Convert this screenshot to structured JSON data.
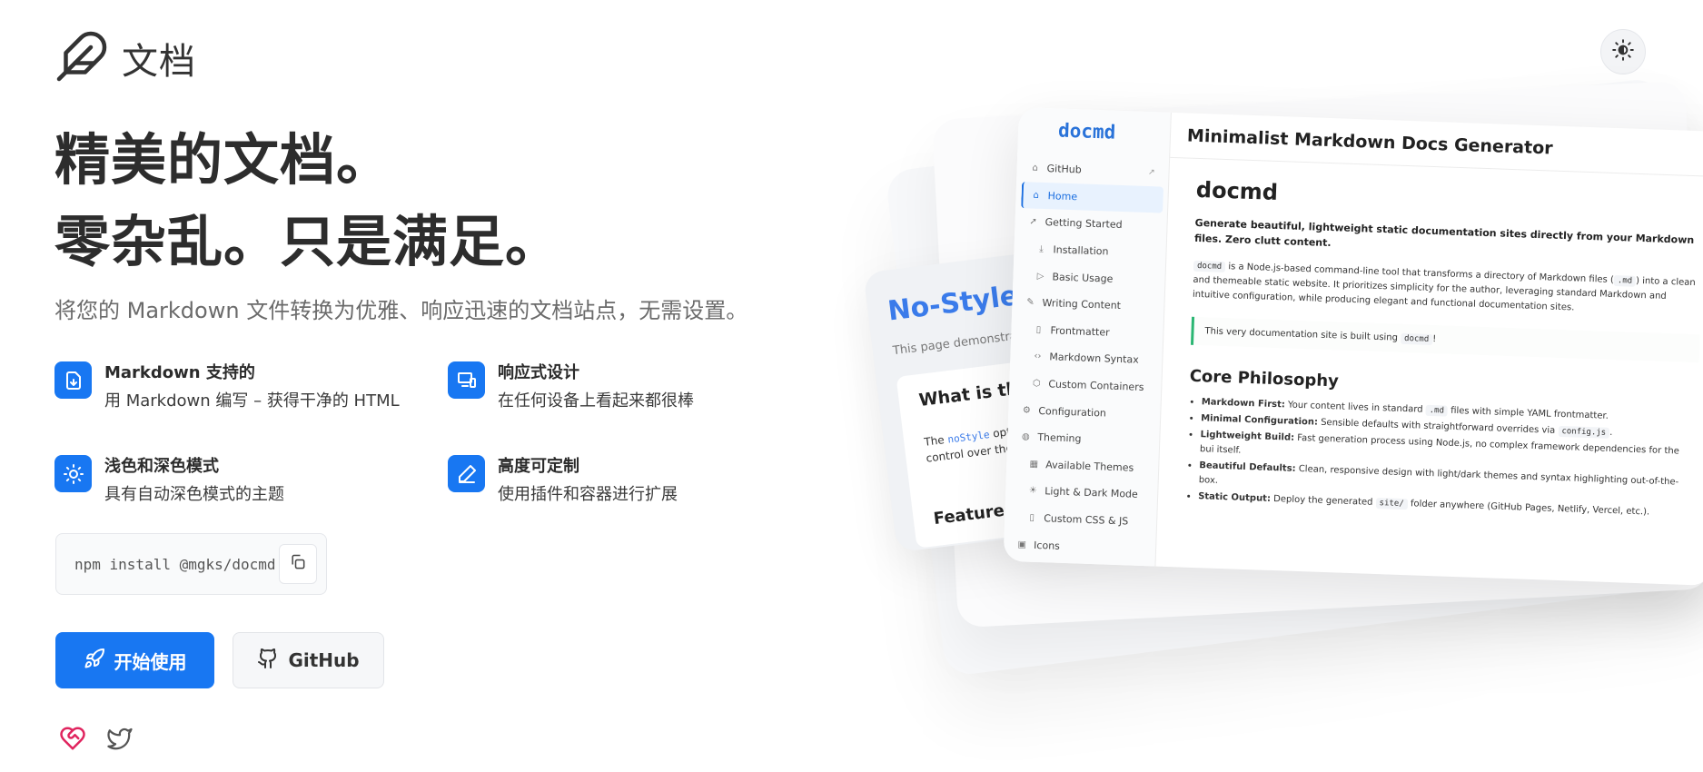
{
  "brand": {
    "name": "文档",
    "icon": "feather-icon"
  },
  "header": {
    "theme_toggle_icon": "sun-moon-icon"
  },
  "hero": {
    "title_line1": "精美的文档。",
    "title_line2": "零杂乱。只是满足。",
    "subtitle": "将您的 Markdown 文件转换为优雅、响应迅速的文档站点，无需设置。"
  },
  "features": [
    {
      "icon": "file-download-icon",
      "title": "Markdown 支持的",
      "desc": "用 Markdown 编写 – 获得干净的 HTML"
    },
    {
      "icon": "devices-icon",
      "title": "响应式设计",
      "desc": "在任何设备上看起来都很棒"
    },
    {
      "icon": "sun-icon",
      "title": "浅色和深色模式",
      "desc": "具有自动深色模式的主题"
    },
    {
      "icon": "pencil-icon",
      "title": "高度可定制",
      "desc": "使用插件和容器进行扩展"
    }
  ],
  "install": {
    "command": "npm install @mgks/docmd",
    "copy_icon": "copy-icon"
  },
  "buttons": {
    "primary": "开始使用",
    "secondary": "GitHub"
  },
  "social": [
    "heart-handshake-icon",
    "twitter-icon"
  ],
  "colors": {
    "accent": "#1877f2",
    "quote_border": "#2bb673"
  },
  "preview": {
    "nostyle": {
      "title": "No-Style Pa",
      "subtitle": "This page demonstrates the",
      "section_title": "What is this pa",
      "p1_before": "The ",
      "p1_code": "noStyle",
      "p1_after": " option te",
      "p2": "control over the page s",
      "section2": "Features en"
    },
    "sidebar": {
      "logo": "docmd",
      "items": [
        {
          "label": "GitHub",
          "icon": "github-icon",
          "sub": false,
          "active": false,
          "external": true
        },
        {
          "label": "Home",
          "icon": "home-icon",
          "sub": false,
          "active": true
        },
        {
          "label": "Getting Started",
          "icon": "rocket-icon",
          "sub": false,
          "active": false
        },
        {
          "label": "Installation",
          "icon": "download-icon",
          "sub": true,
          "active": false
        },
        {
          "label": "Basic Usage",
          "icon": "play-icon",
          "sub": true,
          "active": false
        },
        {
          "label": "Writing Content",
          "icon": "pen-icon",
          "sub": false,
          "active": false
        },
        {
          "label": "Frontmatter",
          "icon": "file-icon",
          "sub": true,
          "active": false
        },
        {
          "label": "Markdown Syntax",
          "icon": "code-icon",
          "sub": true,
          "active": false
        },
        {
          "label": "Custom Containers",
          "icon": "box-icon",
          "sub": true,
          "active": false
        },
        {
          "label": "Configuration",
          "icon": "settings-icon",
          "sub": false,
          "active": false
        },
        {
          "label": "Theming",
          "icon": "palette-icon",
          "sub": false,
          "active": false
        },
        {
          "label": "Available Themes",
          "icon": "grid-icon",
          "sub": true,
          "active": false
        },
        {
          "label": "Light & Dark Mode",
          "icon": "sun-icon",
          "sub": true,
          "active": false
        },
        {
          "label": "Custom CSS & JS",
          "icon": "file-code-icon",
          "sub": true,
          "active": false
        },
        {
          "label": "Icons",
          "icon": "image-icon",
          "sub": false,
          "active": false
        }
      ]
    },
    "doc": {
      "header": "Minimalist Markdown Docs Generator",
      "h1": "docmd",
      "lead": "Generate beautiful, lightweight static documentation sites directly from your Markdown files. Zero clutt content.",
      "p_code1": "docmd",
      "p_a": " is a Node.js-based command-line tool that transforms a directory of Markdown files (",
      "p_code2": ".md",
      "p_b": ") into a clean and themeable static website. It prioritizes simplicity for the author, leveraging standard Markdown and intuitive configuration, while producing elegant and functional documentation sites.",
      "quote_a": "This very documentation site is built using ",
      "quote_code": "docmd",
      "quote_b": "!",
      "h2": "Core Philosophy",
      "list": [
        {
          "b": "Markdown First:",
          "a": " Your content lives in standard ",
          "code": ".md",
          "c": " files with simple YAML frontmatter."
        },
        {
          "b": "Minimal Configuration:",
          "a": " Sensible defaults with straightforward overrides via ",
          "code": "config.js",
          "c": "."
        },
        {
          "b": "Lightweight Build:",
          "a": " Fast generation process using Node.js, no complex framework dependencies for the bui itself.",
          "code": "",
          "c": ""
        },
        {
          "b": "Beautiful Defaults:",
          "a": " Clean, responsive design with light/dark themes and syntax highlighting out-of-the-box.",
          "code": "",
          "c": ""
        },
        {
          "b": "Static Output:",
          "a": " Deploy the generated ",
          "code": "site/",
          "c": " folder anywhere (GitHub Pages, Netlify, Vercel, etc.)."
        }
      ]
    }
  }
}
